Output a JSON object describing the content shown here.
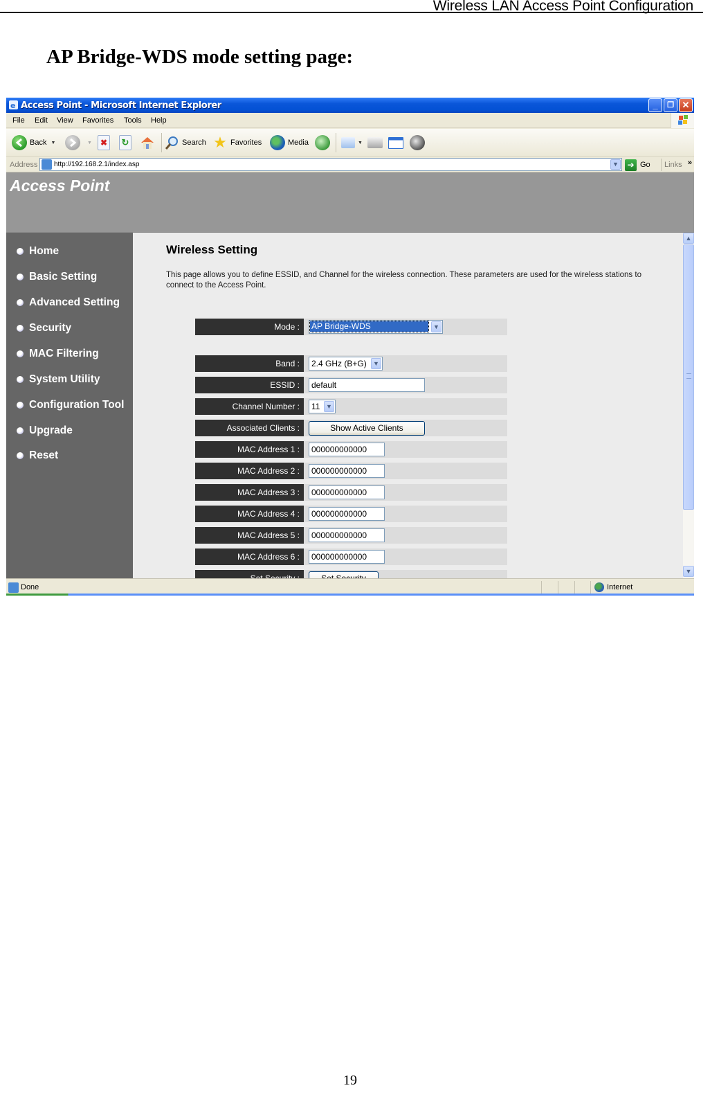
{
  "document": {
    "header_title": "Wireless LAN Access Point Configuration",
    "section_title": "AP Bridge-WDS mode setting page:",
    "page_number": "19"
  },
  "browser": {
    "window_title": "Access Point - Microsoft Internet Explorer",
    "menu": [
      "File",
      "Edit",
      "View",
      "Favorites",
      "Tools",
      "Help"
    ],
    "toolbar": {
      "back": "Back",
      "search": "Search",
      "favorites": "Favorites",
      "media": "Media"
    },
    "address_label": "Address",
    "address_url": "http://192.168.2.1/index.asp",
    "go_label": "Go",
    "links_label": "Links",
    "status_text": "Done",
    "zone_text": "Internet"
  },
  "webpage": {
    "banner_title": "Access Point",
    "nav": [
      "Home",
      "Basic Setting",
      "Advanced Setting",
      "Security",
      "MAC Filtering",
      "System Utility",
      "Configuration Tool",
      "Upgrade",
      "Reset"
    ],
    "title": "Wireless Setting",
    "description": "This page allows you to define ESSID, and Channel for the wireless connection. These parameters are used for the wireless stations to connect to the Access Point.",
    "form": {
      "mode": {
        "label": "Mode :",
        "value": "AP Bridge-WDS"
      },
      "band": {
        "label": "Band :",
        "value": "2.4 GHz (B+G)"
      },
      "essid": {
        "label": "ESSID :",
        "value": "default"
      },
      "channel": {
        "label": "Channel Number :",
        "value": "11"
      },
      "clients": {
        "label": "Associated Clients :",
        "button": "Show Active Clients"
      },
      "mac_addresses": [
        {
          "label": "MAC Address 1 :",
          "value": "000000000000"
        },
        {
          "label": "MAC Address 2 :",
          "value": "000000000000"
        },
        {
          "label": "MAC Address 3 :",
          "value": "000000000000"
        },
        {
          "label": "MAC Address 4 :",
          "value": "000000000000"
        },
        {
          "label": "MAC Address 5 :",
          "value": "000000000000"
        },
        {
          "label": "MAC Address 6 :",
          "value": "000000000000"
        }
      ],
      "security": {
        "label": "Set Security :",
        "button": "Set Security"
      }
    }
  }
}
